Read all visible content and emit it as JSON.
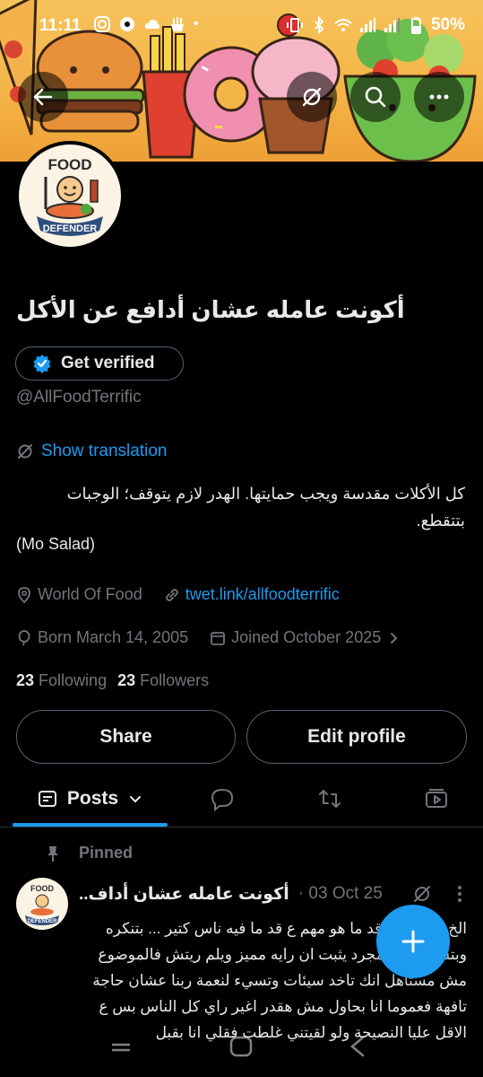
{
  "status_bar": {
    "time": "11:11",
    "battery": "50%"
  },
  "profile": {
    "avatar_text_top": "FOOD",
    "avatar_text_bottom": "DEFENDER",
    "display_name": "أكونت عامله عشان أدافع عن الأكل",
    "verified_label": "Get verified",
    "handle": "@AllFoodTerrific",
    "show_translation": "Show translation",
    "bio_line1": "كل الأكلات مقدسة ويجب حمايتها. الهدر لازم يتوقف؛ الوجبات بتتقطع.",
    "bio_line2": "(Mo Salad)",
    "location": "World Of Food",
    "link": "twet.link/allfoodterrific",
    "born": "Born March 14, 2005",
    "joined": "Joined October 2025",
    "following_count": "23",
    "following_label": "Following",
    "followers_count": "23",
    "followers_label": "Followers",
    "share_label": "Share",
    "edit_label": "Edit profile"
  },
  "tabs": {
    "posts_label": "Posts"
  },
  "pinned_post": {
    "pinned_label": "Pinned",
    "author": "أكونت عامله عشان أداف..",
    "date": "· 03 Oct 25",
    "body": "الخ... الاكل ع قد ما هو مهم ع قد ما فيه ناس كتير ... بتنكره وبتسخر منه لمجرد يثبت ان رايه مميز ويلم ريتش فالموضوع مش مستاهل انك تاخد سيئات وتسيء لنعمة ربنا عشان حاجة تافهة فعموما انا بحاول مش هقدر اغير راي كل الناس بس ع الاقل عليا النصيحة ولو لقيتني غلطت فقلي انا بقبل"
  },
  "colors": {
    "accent": "#1d9bf0",
    "background": "#000000",
    "text_primary": "#e7e9ea",
    "text_secondary": "#71767b",
    "border": "#536471"
  }
}
